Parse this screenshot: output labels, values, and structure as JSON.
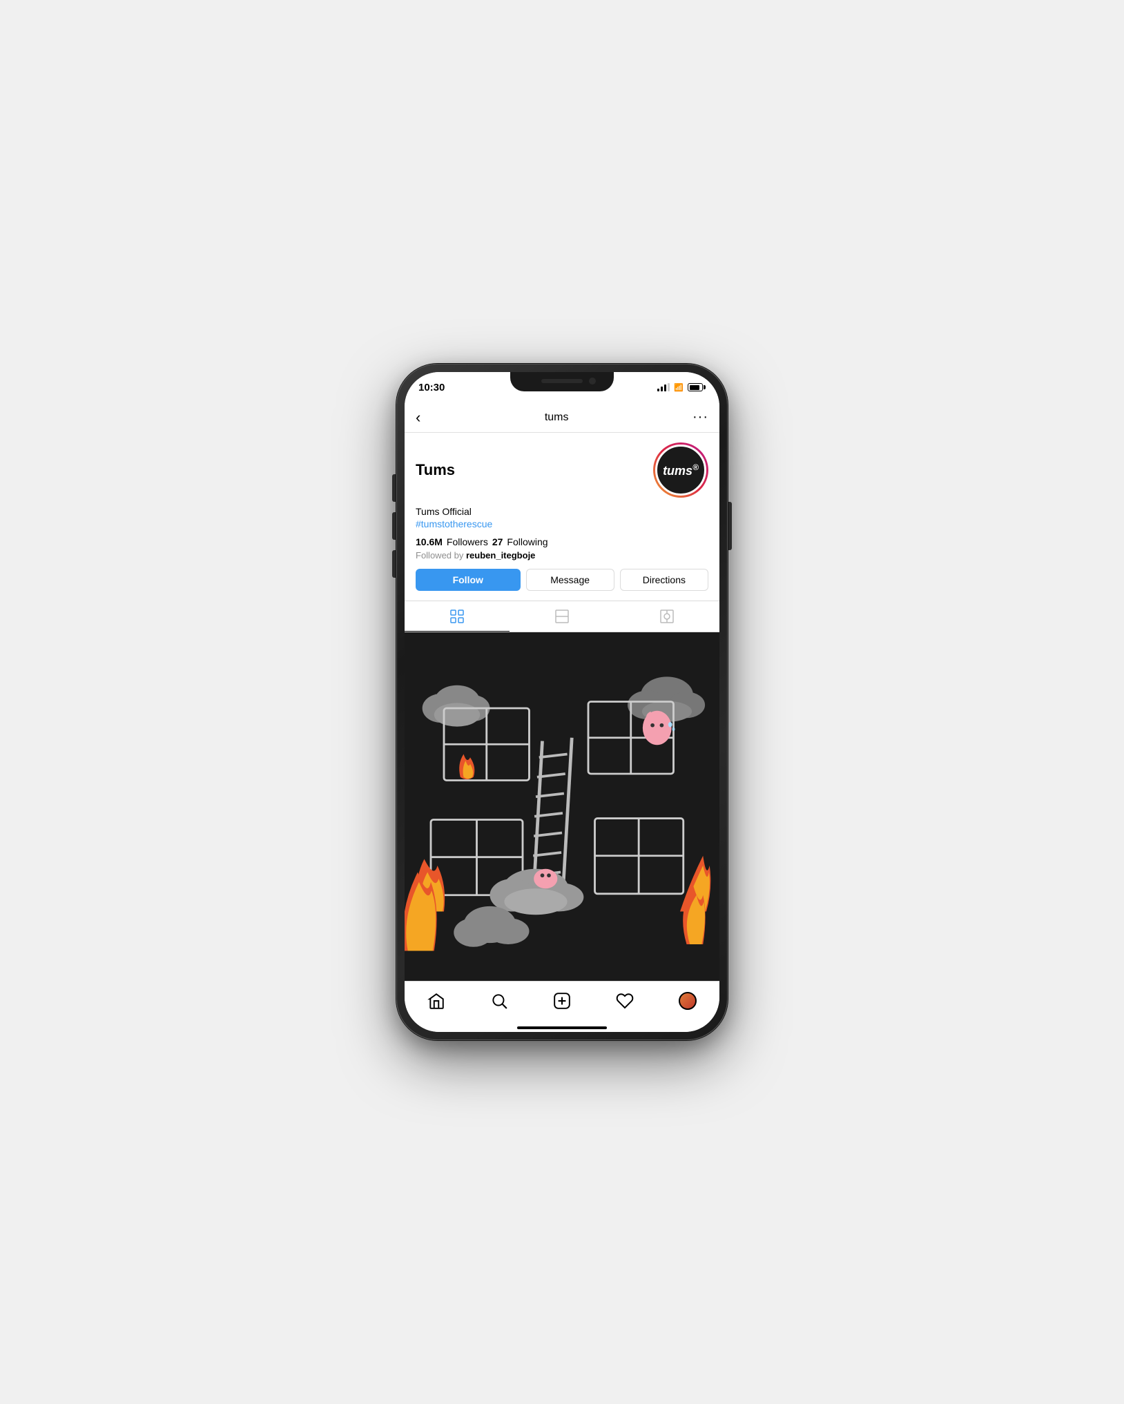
{
  "status": {
    "time": "10:30",
    "location_arrow": "↗"
  },
  "nav": {
    "back": "‹",
    "title": "tums",
    "more": "···"
  },
  "profile": {
    "name": "Tums",
    "bio_name": "Tums Official",
    "hashtag": "#tumstotherescue",
    "followers_count": "10.6M",
    "followers_label": "Followers",
    "following_count": "27",
    "following_label": "Following",
    "followed_by_prefix": "Followed by",
    "followed_by_user": "reuben_itegboje",
    "avatar_text": "tums",
    "avatar_r": "®"
  },
  "buttons": {
    "follow": "Follow",
    "message": "Message",
    "directions": "Directions"
  },
  "tabs": {
    "grid_label": "grid",
    "list_label": "list",
    "tagged_label": "tagged"
  },
  "bottom_nav": {
    "home": "home",
    "search": "search",
    "add": "add",
    "heart": "heart",
    "profile": "profile"
  }
}
